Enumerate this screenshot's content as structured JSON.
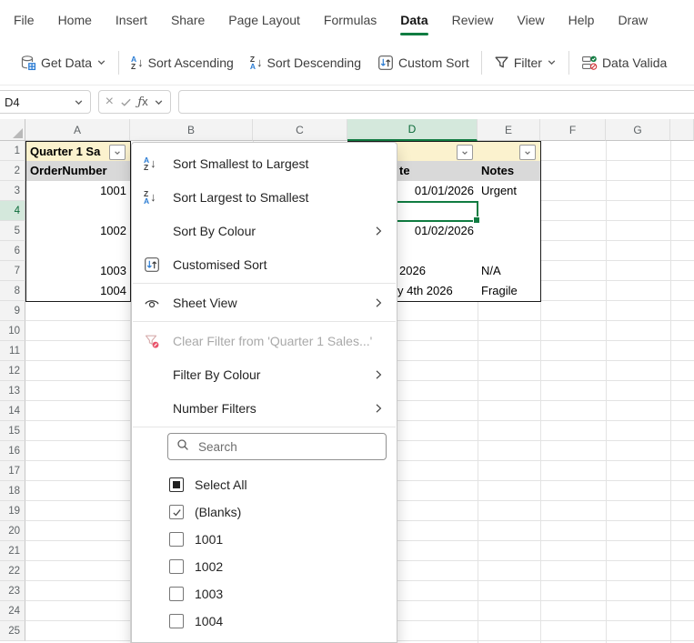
{
  "tabs": {
    "active": "Data",
    "items": [
      "File",
      "Home",
      "Insert",
      "Share",
      "Page Layout",
      "Formulas",
      "Data",
      "Review",
      "View",
      "Help",
      "Draw"
    ]
  },
  "ribbon": {
    "items": [
      {
        "label": "Get Data",
        "icon": "database-icon",
        "dropdown": true
      },
      {
        "separator": true
      },
      {
        "label": "Sort Ascending",
        "icon": "sort-ascending-icon"
      },
      {
        "label": "Sort Descending",
        "icon": "sort-descending-icon"
      },
      {
        "label": "Custom Sort",
        "icon": "custom-sort-icon"
      },
      {
        "separator": true
      },
      {
        "label": "Filter",
        "icon": "filter-icon",
        "dropdown": true
      },
      {
        "separator": true
      },
      {
        "label": "Data Valida",
        "icon": "data-validation-icon"
      }
    ]
  },
  "formula_bar": {
    "name_box": "D4",
    "value": "",
    "buttons": [
      "cancel-icon",
      "check-icon",
      "fx-icon",
      "chevron-down-icon"
    ]
  },
  "sheet": {
    "column_headers": [
      "A",
      "B",
      "C",
      "D",
      "E",
      "F",
      "G"
    ],
    "row_headers": [
      "1",
      "2",
      "3",
      "4",
      "5",
      "6",
      "7",
      "8",
      "9",
      "10",
      "11",
      "12",
      "13",
      "14",
      "15",
      "16",
      "17",
      "18",
      "19",
      "20",
      "21",
      "22",
      "23",
      "24",
      "25"
    ],
    "selected_column": "D",
    "selected_row": "4",
    "selected_cell": "D4",
    "cells": [
      {
        "col": "A",
        "row": 1,
        "text": "Quarter 1 Sa",
        "type": "title",
        "dropdown": true
      },
      {
        "col": "D",
        "row": 1,
        "text": "",
        "type": "title",
        "dropdown": true
      },
      {
        "col": "E",
        "row": 1,
        "text": "",
        "type": "title",
        "dropdown": true
      },
      {
        "col": "A",
        "row": 2,
        "text": "OrderNumber",
        "type": "header"
      },
      {
        "col": "D",
        "row": 2,
        "text": "te",
        "type": "header",
        "indent": 57
      },
      {
        "col": "E",
        "row": 2,
        "text": "Notes",
        "type": "header"
      },
      {
        "col": "A",
        "row": 3,
        "text": "1001",
        "type": "number"
      },
      {
        "col": "D",
        "row": 3,
        "text": "01/01/2026",
        "type": "number"
      },
      {
        "col": "E",
        "row": 3,
        "text": "Urgent",
        "type": "text"
      },
      {
        "col": "A",
        "row": 4,
        "text": "",
        "type": "blank"
      },
      {
        "col": "D",
        "row": 4,
        "text": "",
        "type": "blank"
      },
      {
        "col": "E",
        "row": 4,
        "text": "",
        "type": "blank"
      },
      {
        "col": "A",
        "row": 5,
        "text": "1002",
        "type": "number"
      },
      {
        "col": "D",
        "row": 5,
        "text": "01/02/2026",
        "type": "number"
      },
      {
        "col": "E",
        "row": 5,
        "text": "",
        "type": "blank"
      },
      {
        "col": "A",
        "row": 6,
        "text": "",
        "type": "blank"
      },
      {
        "col": "D",
        "row": 6,
        "text": "",
        "type": "blank"
      },
      {
        "col": "E",
        "row": 6,
        "text": "",
        "type": "blank"
      },
      {
        "col": "A",
        "row": 7,
        "text": "1003",
        "type": "number"
      },
      {
        "col": "D",
        "row": 7,
        "text": "2026",
        "type": "text",
        "indent": 57
      },
      {
        "col": "E",
        "row": 7,
        "text": "N/A",
        "type": "text"
      },
      {
        "col": "A",
        "row": 8,
        "text": "1004",
        "type": "number"
      },
      {
        "col": "D",
        "row": 8,
        "text": "y 4th 2026",
        "type": "text",
        "indent": 55
      },
      {
        "col": "E",
        "row": 8,
        "text": "Fragile",
        "type": "text"
      }
    ]
  },
  "filter_menu": {
    "items": [
      {
        "label": "Sort Smallest to Largest",
        "icon": "sort-ascending-icon"
      },
      {
        "label": "Sort Largest to Smallest",
        "icon": "sort-descending-icon"
      },
      {
        "label": "Sort By Colour",
        "submenu": true
      },
      {
        "label": "Customised Sort",
        "icon": "custom-sort-icon"
      },
      {
        "separator": true
      },
      {
        "label": "Sheet View",
        "icon": "eye-icon",
        "submenu": true
      },
      {
        "separator": true
      },
      {
        "label": "Clear Filter from 'Quarter 1 Sales...'",
        "icon": "clear-filter-icon",
        "disabled": true
      },
      {
        "label": "Filter By Colour",
        "submenu": true
      },
      {
        "label": "Number Filters",
        "submenu": true
      },
      {
        "separator": true
      }
    ],
    "search_placeholder": "Search",
    "values": [
      {
        "label": "Select All",
        "state": "indeterminate"
      },
      {
        "label": "(Blanks)",
        "state": "checked"
      },
      {
        "label": "1001",
        "state": "unchecked"
      },
      {
        "label": "1002",
        "state": "unchecked"
      },
      {
        "label": "1003",
        "state": "unchecked"
      },
      {
        "label": "1004",
        "state": "unchecked"
      }
    ]
  },
  "colors": {
    "accent_green": "#107C41",
    "selected_header_bg": "#D4E8DC",
    "table_title_bg": "#FBF2CE",
    "table_header_bg": "#D9D9D9",
    "icon_blue": "#2B7CD3",
    "disabled_text": "#A9A9A9"
  }
}
